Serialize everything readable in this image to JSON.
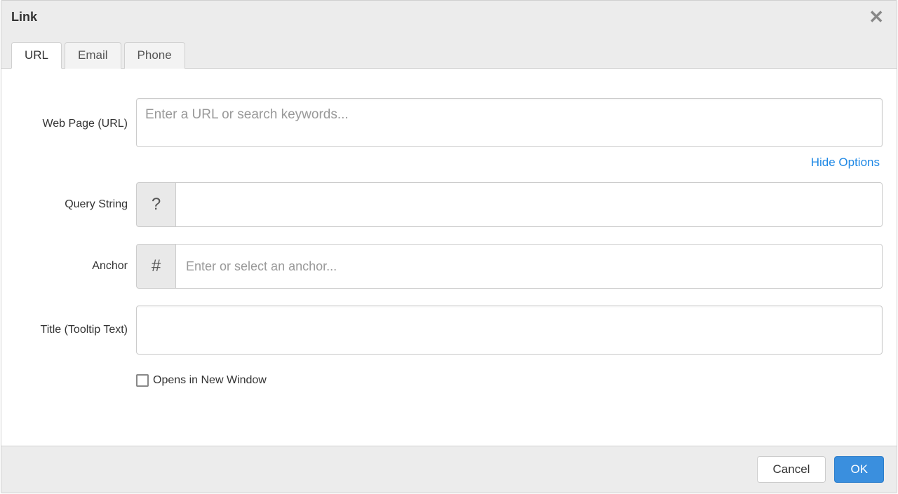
{
  "dialog": {
    "title": "Link"
  },
  "tabs": {
    "url": "URL",
    "email": "Email",
    "phone": "Phone"
  },
  "form": {
    "url_label": "Web Page (URL)",
    "url_placeholder": "Enter a URL or search keywords...",
    "url_value": "",
    "hide_options": "Hide Options",
    "query_label": "Query String",
    "query_prefix": "?",
    "query_value": "",
    "anchor_label": "Anchor",
    "anchor_prefix": "#",
    "anchor_placeholder": "Enter or select an anchor...",
    "anchor_value": "",
    "title_label": "Title (Tooltip Text)",
    "title_value": "",
    "new_window_label": "Opens in New Window"
  },
  "buttons": {
    "cancel": "Cancel",
    "ok": "OK"
  }
}
